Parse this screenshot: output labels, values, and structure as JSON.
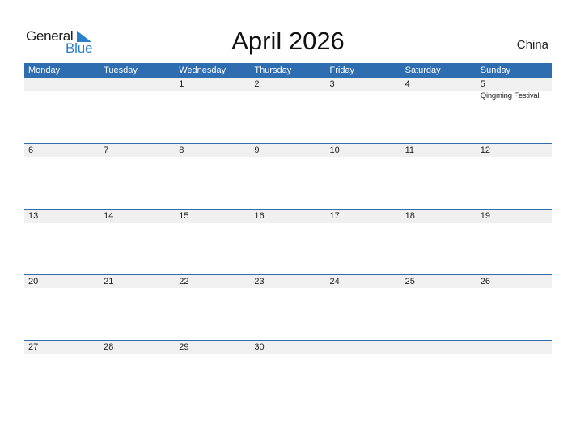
{
  "logo": {
    "general": "General",
    "blue": "Blue"
  },
  "title": "April 2026",
  "country": "China",
  "colors": {
    "accent": "#2e6db0",
    "logo_blue": "#2a7fc8",
    "date_band": "#f0f0f0"
  },
  "weekdays": [
    "Monday",
    "Tuesday",
    "Wednesday",
    "Thursday",
    "Friday",
    "Saturday",
    "Sunday"
  ],
  "weeks": [
    {
      "days": [
        {
          "date": "",
          "holiday": ""
        },
        {
          "date": "",
          "holiday": ""
        },
        {
          "date": "1",
          "holiday": ""
        },
        {
          "date": "2",
          "holiday": ""
        },
        {
          "date": "3",
          "holiday": ""
        },
        {
          "date": "4",
          "holiday": ""
        },
        {
          "date": "5",
          "holiday": "Qingming Festival"
        }
      ]
    },
    {
      "days": [
        {
          "date": "6",
          "holiday": ""
        },
        {
          "date": "7",
          "holiday": ""
        },
        {
          "date": "8",
          "holiday": ""
        },
        {
          "date": "9",
          "holiday": ""
        },
        {
          "date": "10",
          "holiday": ""
        },
        {
          "date": "11",
          "holiday": ""
        },
        {
          "date": "12",
          "holiday": ""
        }
      ]
    },
    {
      "days": [
        {
          "date": "13",
          "holiday": ""
        },
        {
          "date": "14",
          "holiday": ""
        },
        {
          "date": "15",
          "holiday": ""
        },
        {
          "date": "16",
          "holiday": ""
        },
        {
          "date": "17",
          "holiday": ""
        },
        {
          "date": "18",
          "holiday": ""
        },
        {
          "date": "19",
          "holiday": ""
        }
      ]
    },
    {
      "days": [
        {
          "date": "20",
          "holiday": ""
        },
        {
          "date": "21",
          "holiday": ""
        },
        {
          "date": "22",
          "holiday": ""
        },
        {
          "date": "23",
          "holiday": ""
        },
        {
          "date": "24",
          "holiday": ""
        },
        {
          "date": "25",
          "holiday": ""
        },
        {
          "date": "26",
          "holiday": ""
        }
      ]
    },
    {
      "days": [
        {
          "date": "27",
          "holiday": ""
        },
        {
          "date": "28",
          "holiday": ""
        },
        {
          "date": "29",
          "holiday": ""
        },
        {
          "date": "30",
          "holiday": ""
        },
        {
          "date": "",
          "holiday": ""
        },
        {
          "date": "",
          "holiday": ""
        },
        {
          "date": "",
          "holiday": ""
        }
      ]
    }
  ]
}
